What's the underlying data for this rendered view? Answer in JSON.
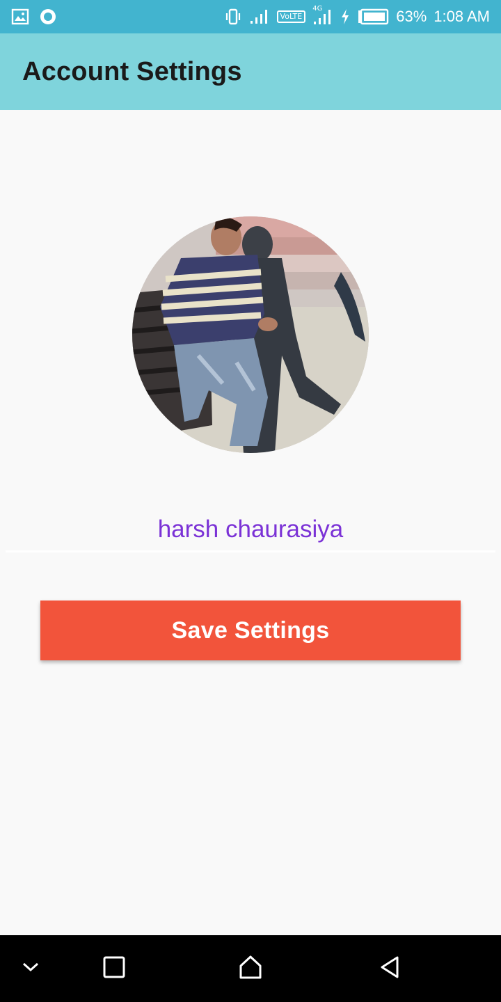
{
  "status_bar": {
    "battery_percent": "63%",
    "time": "1:08 AM",
    "volte_label": "VoLTE",
    "network_label": "4G",
    "left_icons": [
      "gallery-icon",
      "circle-notification-icon"
    ],
    "right_icons": [
      "vibrate-icon",
      "signal-icon",
      "volte-icon",
      "4g-signal-icon",
      "charging-icon",
      "battery-icon"
    ],
    "background": "#42b4cf"
  },
  "app_bar": {
    "title": "Account Settings",
    "background": "#7fd4dc"
  },
  "profile": {
    "display_name": "harsh chaurasiya",
    "name_color": "#7b32d6"
  },
  "actions": {
    "save_label": "Save Settings",
    "save_color": "#f2543b"
  },
  "nav_bar": {
    "icons": [
      "chevron-down-icon",
      "recents-icon",
      "home-icon",
      "back-icon"
    ]
  }
}
